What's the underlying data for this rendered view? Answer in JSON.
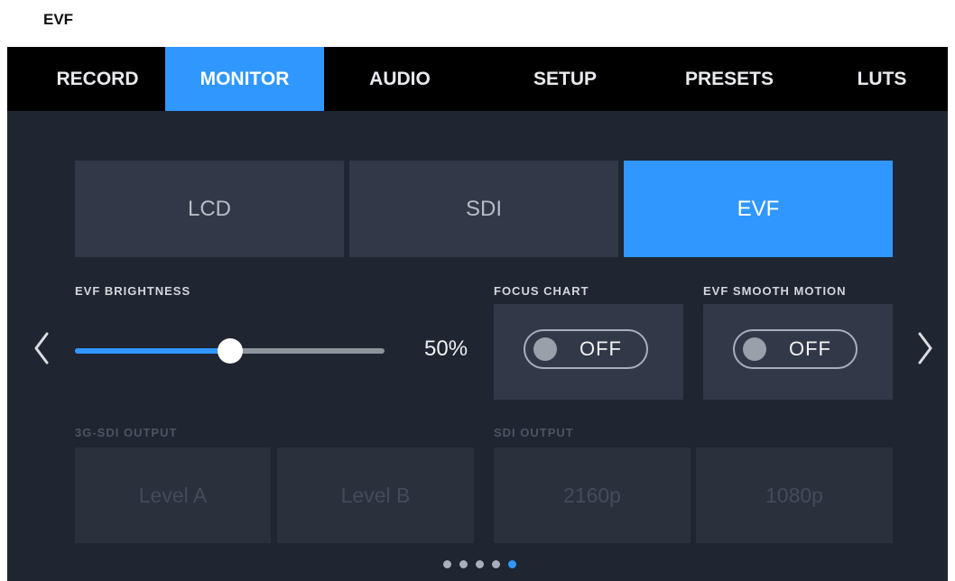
{
  "page_heading": "EVF",
  "tabs": [
    {
      "label": "RECORD"
    },
    {
      "label": "MONITOR"
    },
    {
      "label": "AUDIO"
    },
    {
      "label": "SETUP"
    },
    {
      "label": "PRESETS"
    },
    {
      "label": "LUTS"
    }
  ],
  "active_tab": "MONITOR",
  "outputs": [
    {
      "label": "LCD"
    },
    {
      "label": "SDI"
    },
    {
      "label": "EVF"
    }
  ],
  "active_output": "EVF",
  "evf_brightness": {
    "label": "EVF BRIGHTNESS",
    "value_text": "50%",
    "value": 50
  },
  "focus_chart": {
    "label": "FOCUS CHART",
    "state": "OFF"
  },
  "evf_smooth_motion": {
    "label": "EVF SMOOTH MOTION",
    "state": "OFF"
  },
  "sdi_3g_output": {
    "label": "3G-SDI OUTPUT",
    "options": [
      "Level A",
      "Level B"
    ]
  },
  "sdi_output": {
    "label": "SDI OUTPUT",
    "options": [
      "2160p",
      "1080p"
    ]
  },
  "pagination": {
    "count": 5,
    "active_index": 4
  },
  "colors": {
    "accent": "#2f97ff",
    "background": "#1f2531",
    "panel": "#313948",
    "tabbar": "#000000"
  },
  "icons": {
    "prev": "chevron-left-icon",
    "next": "chevron-right-icon"
  }
}
